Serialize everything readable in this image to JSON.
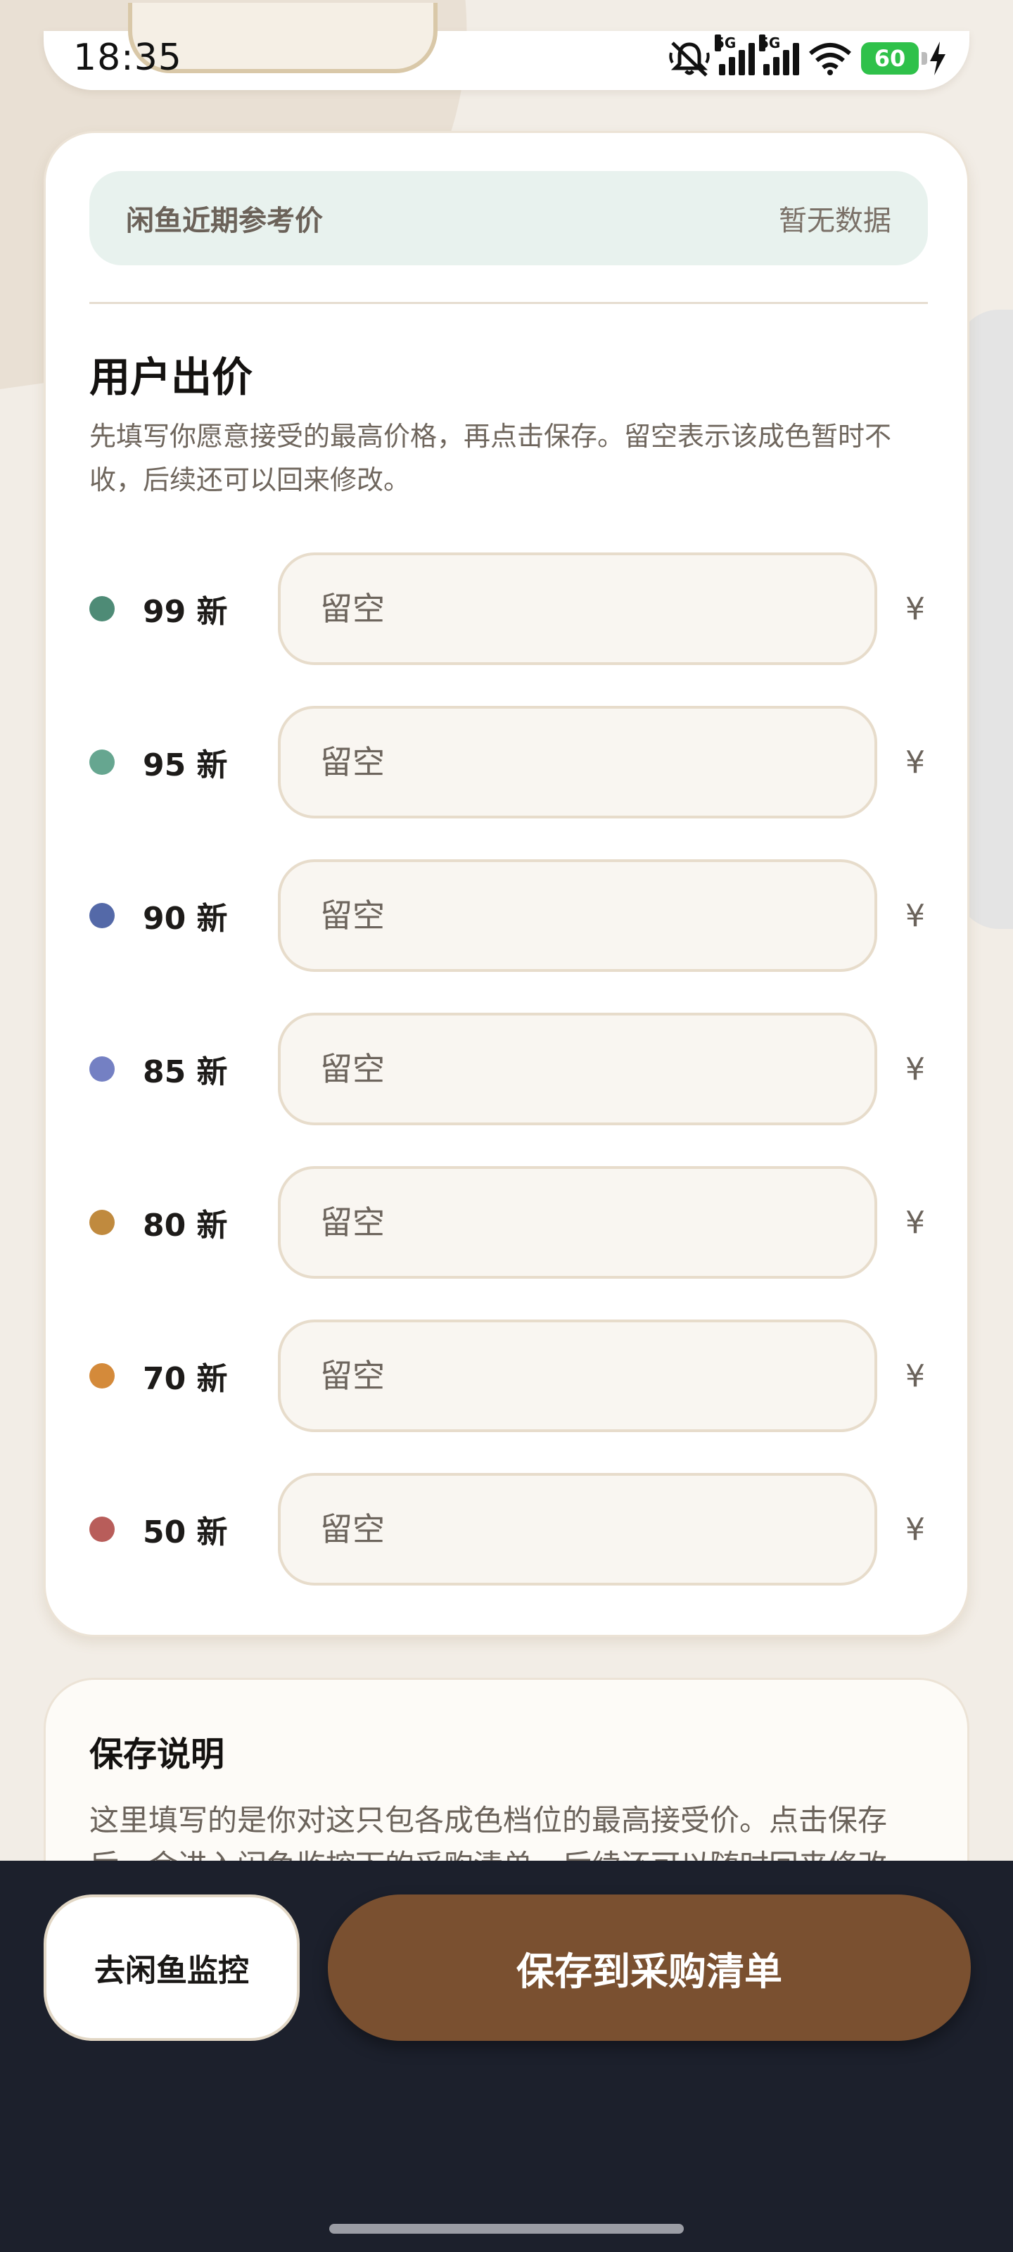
{
  "status_bar": {
    "time": "18:35",
    "network_label": "5G",
    "battery": "60"
  },
  "reference_price": {
    "label": "闲鱼近期参考价",
    "value": "暂无数据"
  },
  "user_bid": {
    "title": "用户出价",
    "description": "先填写你愿意接受的最高价格，再点击保存。留空表示该成色暂时不收，后续还可以回来修改。",
    "currency_symbol": "¥",
    "rows": [
      {
        "grade": "99 新",
        "placeholder": "留空",
        "color": "#4e8b76"
      },
      {
        "grade": "95 新",
        "placeholder": "留空",
        "color": "#66a690"
      },
      {
        "grade": "90 新",
        "placeholder": "留空",
        "color": "#5469a8"
      },
      {
        "grade": "85 新",
        "placeholder": "留空",
        "color": "#7480c3"
      },
      {
        "grade": "80 新",
        "placeholder": "留空",
        "color": "#c08a3e"
      },
      {
        "grade": "70 新",
        "placeholder": "留空",
        "color": "#d48a3a"
      },
      {
        "grade": "50 新",
        "placeholder": "留空",
        "color": "#b85d5a"
      }
    ]
  },
  "save_info": {
    "title": "保存说明",
    "text": "这里填写的是你对这只包各成色档位的最高接受价。点击保存后，会进入闲鱼监控下的采购清单，后续还可以随时回来修改。"
  },
  "actions": {
    "monitor_label": "去闲鱼监控",
    "save_label": "保存到采购清单"
  }
}
